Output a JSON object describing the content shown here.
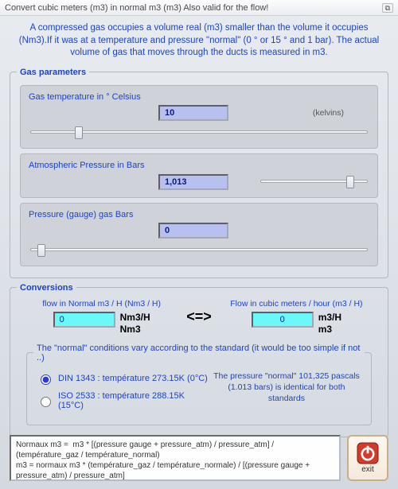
{
  "title": "Convert cubic meters (m3) in normal m3 (m3) Also valid for the flow!",
  "intro": "A compressed gas occupies a volume real (m3) smaller than the volume it occupies (Nm3).If it was at a temperature and pressure \"normal\" (0 ° or 15 ° and 1 bar). The actual volume of gas that moves through the ducts is measured in m3.",
  "gas": {
    "legend": "Gas parameters",
    "temp": {
      "label": "Gas temperature in ° Celsius",
      "value": "10",
      "unit": "(kelvins)",
      "slider_pos_pct": 14
    },
    "atm": {
      "label": "Atmospheric Pressure in Bars",
      "value": "1,013",
      "slider_pos_pct": 78
    },
    "gauge": {
      "label": "Pressure (gauge) gas Bars",
      "value": "0",
      "slider_pos_pct": 3
    }
  },
  "conv": {
    "legend": "Conversions",
    "left": {
      "caption": "flow in Normal m3 / H (Nm3 / H)",
      "value": "0",
      "unit1": "Nm3/H",
      "unit2": "Nm3"
    },
    "arrow": "<=>",
    "right": {
      "caption": "Flow in cubic meters / hour (m3 / H)",
      "value": "0",
      "unit1": "m3/H",
      "unit2": "m3"
    }
  },
  "norm": {
    "legend": "The \"normal\" conditions vary according to the standard (it would be too simple if not ..)",
    "opt1": "DIN 1343 :  température 273.15K (0°C)",
    "opt2": "ISO 2533 :  température  288.15K (15°C)",
    "note": "The pressure \"normal\" 101,325 pascals (1.013 bars) is identical for both standards"
  },
  "formula": "Normaux m3 =  m3 * [(pressure gauge + pressure_atm) / pressure_atm] / (température_gaz / température_normal)\nm3 = normaux m3 * (température_gaz / température_normale) / [(pressure gauge + pressure_atm) / pressure_atm]",
  "exit_label": "exit"
}
